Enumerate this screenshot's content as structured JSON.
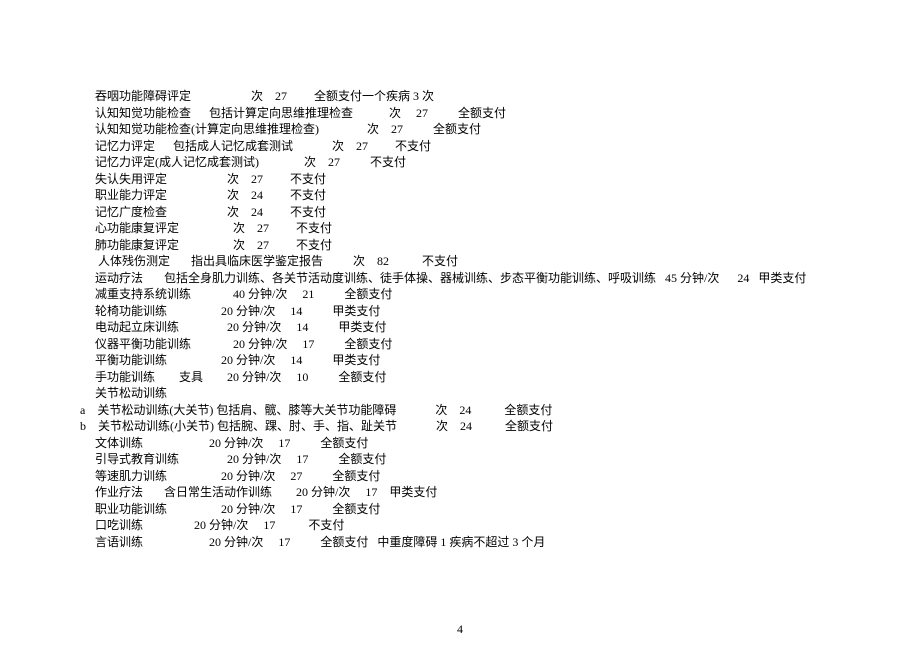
{
  "lines": [
    "     吞咽功能障碍评定                    次    27         全额支付一个疾病 3 次",
    "     认知知觉功能检查      包括计算定向思维推理检查            次     27          全额支付",
    "     认知知觉功能检查(计算定向思维推理检查)                次    27          全额支付",
    "     记忆力评定      包括成人记忆成套测试             次    27         不支付",
    "     记忆力评定(成人记忆成套测试)               次    27          不支付",
    "     失认失用评定                    次    27         不支付",
    "     职业能力评定                    次    24         不支付",
    "     记忆广度检查                    次    24         不支付",
    "     心功能康复评定                  次    27         不支付",
    "     肺功能康复评定                  次    27         不支付",
    "      人体残伤测定       指出具临床医学鉴定报告          次    82           不支付",
    "     运动疗法       包括全身肌力训练、各关节活动度训练、徒手体操、器械训练、步态平衡功能训练、呼吸训练   45 分钟/次      24   甲类支付",
    "     减重支持系统训练              40 分钟/次     21          全额支付",
    "     轮椅功能训练                  20 分钟/次     14          甲类支付",
    "     电动起立床训练                20 分钟/次     14          甲类支付",
    "     仪器平衡功能训练              20 分钟/次     17          全额支付",
    "     平衡功能训练                  20 分钟/次     14          甲类支付",
    "     手功能训练        支具        20 分钟/次     10          全额支付",
    "     关节松动训练",
    "a    关节松动训练(大关节) 包括肩、髋、膝等大关节功能障碍             次    24           全额支付",
    "b    关节松动训练(小关节) 包括腕、踝、肘、手、指、趾关节             次    24           全额支付",
    "     文体训练                      20 分钟/次     17          全额支付",
    "     引导式教育训练                20 分钟/次     17          全额支付",
    "     等速肌力训练                  20 分钟/次     27          全额支付",
    "     作业疗法       含日常生活动作训练        20 分钟/次     17    甲类支付",
    "     职业功能训练                  20 分钟/次     17          全额支付",
    "     口吃训练                 20 分钟/次     17           不支付",
    "     言语训练                      20 分钟/次     17          全额支付   中重度障碍 1 疾病不超过 3 个月"
  ],
  "page_number": "4"
}
